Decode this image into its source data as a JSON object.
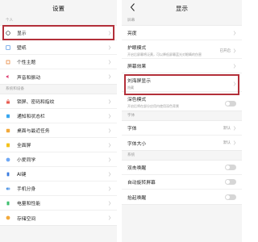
{
  "left": {
    "title": "设置",
    "section_personal": "个人",
    "personal_items": [
      {
        "label": "显示"
      },
      {
        "label": "壁纸"
      },
      {
        "label": "个性主题"
      },
      {
        "label": "声音和振动"
      }
    ],
    "section_system": "系统和设备",
    "system_items": [
      {
        "label": "锁屏、密码和指纹"
      },
      {
        "label": "通知和状态栏"
      },
      {
        "label": "桌面与最近任务"
      },
      {
        "label": "全面屏"
      },
      {
        "label": "小爱同学"
      },
      {
        "label": "AI键"
      },
      {
        "label": "手机分身"
      },
      {
        "label": "电量和性能"
      },
      {
        "label": "存储空间"
      }
    ]
  },
  "right": {
    "title": "显示",
    "section_screen": "屏幕",
    "brightness_label": "亮度",
    "eye_label": "护眼模式",
    "eye_sub": "开启后屏幕将泛黄，可以降低屏幕蓝光对眼睛的伤害",
    "eye_value": "已开启",
    "effect_label": "屏幕效果",
    "notch_label": "刘海屏显示",
    "notch_sub": "隐藏",
    "dark_label": "深色模式",
    "dark_sub": "开启后将在部分应用内使用深色背景",
    "section_font": "字体",
    "font_label": "字体",
    "font_value": "默认",
    "fontsize_label": "字体大小",
    "fontsize_value": "默认",
    "section_system": "系统",
    "doubletap_label": "双击唤醒",
    "autorotate_label": "自动旋转屏幕",
    "raise_label": "抬起唤醒"
  },
  "colors": {
    "highlight": "#b3303a",
    "icon_blue": "#4a90e2"
  }
}
